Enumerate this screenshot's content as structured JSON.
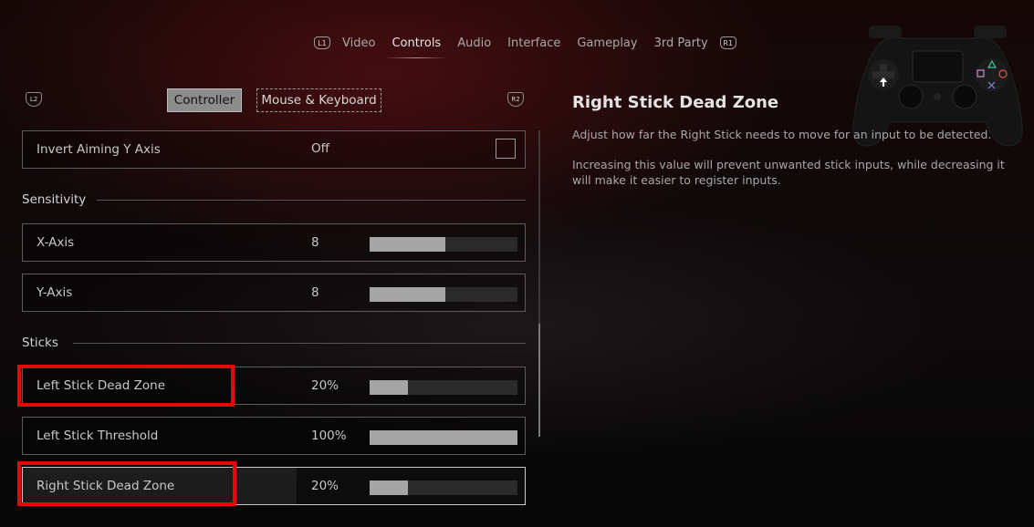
{
  "tabs": {
    "left_button": "L1",
    "right_button": "R1",
    "items": [
      "Video",
      "Controls",
      "Audio",
      "Interface",
      "Gameplay",
      "3rd Party"
    ],
    "active": "Controls"
  },
  "subtabs": {
    "left_button": "L2",
    "right_button": "R2",
    "controller": "Controller",
    "mouse_keyboard": "Mouse & Keyboard"
  },
  "settings": {
    "invert": {
      "label": "Invert Aiming Y Axis",
      "value": "Off"
    },
    "sensitivity_title": "Sensitivity",
    "x_axis": {
      "label": "X-Axis",
      "value": "8",
      "level": 0.51
    },
    "y_axis": {
      "label": "Y-Axis",
      "value": "8",
      "level": 0.51
    },
    "sticks_title": "Sticks",
    "left_dead_zone": {
      "label": "Left Stick Dead Zone",
      "value": "20%",
      "level": 0.26
    },
    "left_threshold": {
      "label": "Left Stick Threshold",
      "value": "100%",
      "level": 1.0
    },
    "right_dead_zone": {
      "label": "Right Stick Dead Zone",
      "value": "20%",
      "level": 0.26
    }
  },
  "detail": {
    "title": "Right Stick Dead Zone",
    "p1": "Adjust how far the Right Stick needs to move for an input to be detected.",
    "p2": "Increasing this value will prevent unwanted stick inputs, while decreasing it will make it easier to register inputs."
  },
  "icons": {
    "controller_image": "gamepad-icon"
  },
  "colors": {
    "highlight": "#e30a0a",
    "slider_fill": "#a5a5a5"
  }
}
